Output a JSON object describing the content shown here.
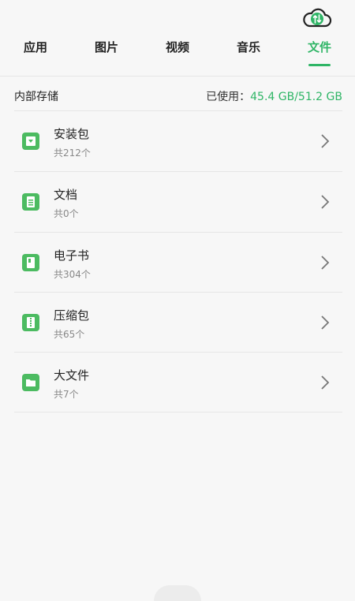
{
  "colors": {
    "accent": "#2fb566",
    "icon_green": "#4cbb61",
    "divider": "#e6e6e6",
    "muted_text": "#888888"
  },
  "header": {
    "cloud_icon": "cloud-transfer-icon",
    "tabs": [
      {
        "label": "应用",
        "active": false
      },
      {
        "label": "图片",
        "active": false
      },
      {
        "label": "视频",
        "active": false
      },
      {
        "label": "音乐",
        "active": false
      },
      {
        "label": "文件",
        "active": true
      }
    ]
  },
  "storage": {
    "title": "内部存储",
    "used_label": "已使用：",
    "used_value": "45.4 GB/51.2 GB"
  },
  "items": [
    {
      "name": "安装包",
      "count": "共212个",
      "icon": "package-icon"
    },
    {
      "name": "文档",
      "count": "共0个",
      "icon": "document-icon"
    },
    {
      "name": "电子书",
      "count": "共304个",
      "icon": "ebook-icon"
    },
    {
      "name": "压缩包",
      "count": "共65个",
      "icon": "archive-icon"
    },
    {
      "name": "大文件",
      "count": "共7个",
      "icon": "folder-icon"
    }
  ]
}
